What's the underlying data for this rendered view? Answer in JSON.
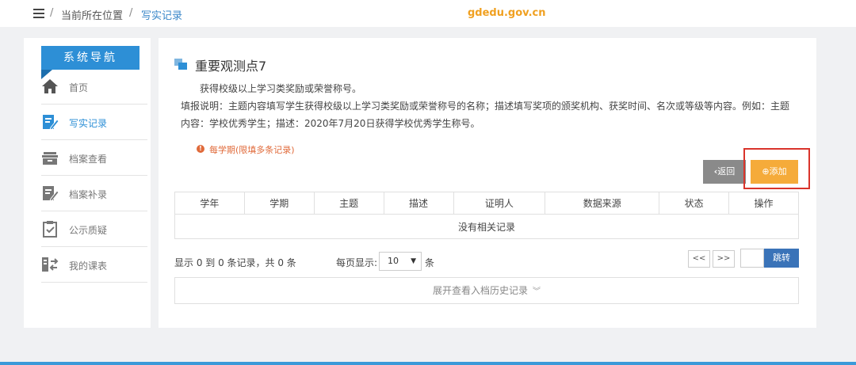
{
  "breadcrumb": {
    "location_label": "当前所在位置",
    "separator": "/",
    "current": "写实记录"
  },
  "watermark": "gdedu.gov.cn",
  "sidebar": {
    "title": "系统导航",
    "items": [
      {
        "label": "首页",
        "icon": "home-icon",
        "active": false
      },
      {
        "label": "写实记录",
        "icon": "edit-record-icon",
        "active": true
      },
      {
        "label": "档案查看",
        "icon": "archive-box-icon",
        "active": false
      },
      {
        "label": "档案补录",
        "icon": "supplement-edit-icon",
        "active": false
      },
      {
        "label": "公示质疑",
        "icon": "clipboard-check-icon",
        "active": false
      },
      {
        "label": "我的课表",
        "icon": "schedule-swap-icon",
        "active": false
      }
    ]
  },
  "main": {
    "title": "重要观测点7",
    "subtitle": "获得校级以上学习类奖励或荣誉称号。",
    "description": "填报说明：主题内容填写学生获得校级以上学习类奖励或荣誉称号的名称；描述填写奖项的颁奖机构、获奖时间、名次或等级等内容。例如：主题内容：学校优秀学生；描述：2020年7月20日获得学校优秀学生称号。",
    "notice": "每学期(限填多条记录)",
    "back_label": "返回",
    "add_label": "添加",
    "table": {
      "columns": [
        "学年",
        "学期",
        "主题",
        "描述",
        "证明人",
        "数据来源",
        "状态",
        "操作"
      ],
      "empty_text": "没有相关记录"
    },
    "summary": "显示 0 到 0 条记录，共 0 条",
    "per_page_label": "每页显示:",
    "per_page_value": "10",
    "per_page_unit": "条",
    "pager": {
      "prev": "<<",
      "next": ">>",
      "jump_label": "跳转"
    },
    "history_label": "展开查看入档历史记录"
  },
  "colors": {
    "accent": "#2d8fd6",
    "add_button": "#f5ab3a",
    "back_button": "#8a8a8a",
    "highlight_box": "#d9342b",
    "notice": "#e06a3a"
  }
}
